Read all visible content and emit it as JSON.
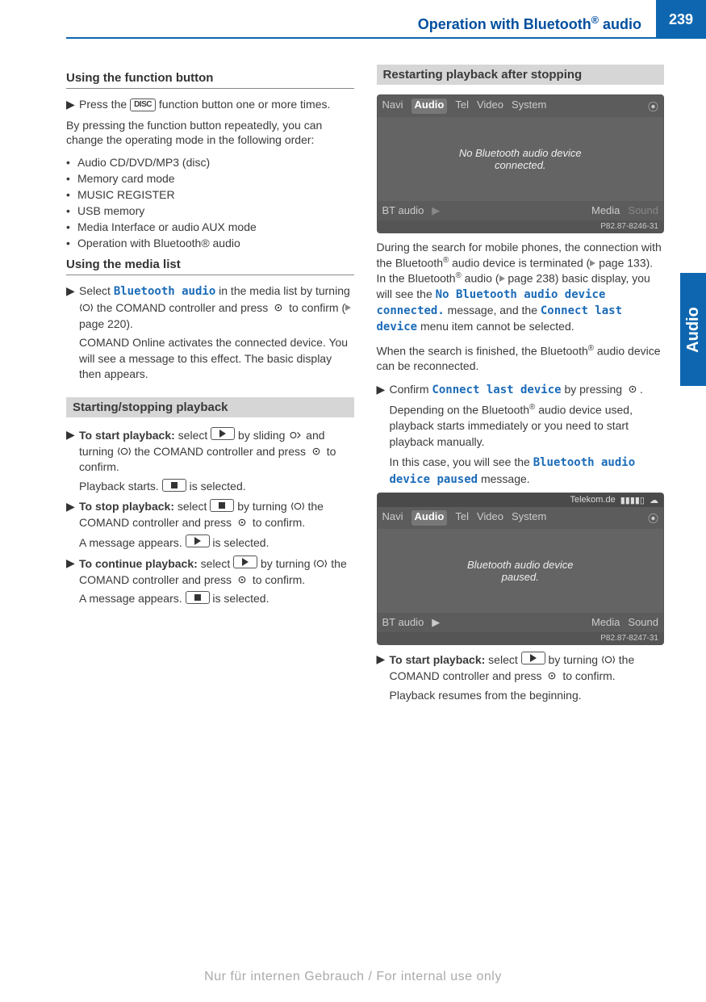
{
  "header": {
    "title_pre": "Operation with Bluetooth",
    "title_sup": "®",
    "title_post": " audio",
    "page_number": "239"
  },
  "side_tab": "Audio",
  "left": {
    "subhead1": "Using the function button",
    "disc_label": "DISC",
    "step1_pre": "Press the ",
    "step1_post": " function button one or more times.",
    "para1": "By pressing the function button repeatedly, you can change the operating mode in the following order:",
    "bullets": [
      "Audio CD/DVD/MP3 (disc)",
      "Memory card mode",
      "MUSIC REGISTER",
      "USB memory",
      "Media Interface or audio AUX mode",
      "Operation with Bluetooth® audio"
    ],
    "subhead2": "Using the media list",
    "bt_audio": "Bluetooth audio",
    "step2_pre": "Select ",
    "step2_mid1": " in the media list by turning ",
    "step2_mid2": " the COMAND controller and press ",
    "step2_post": " to confirm (",
    "page220": "page 220).",
    "step2_desc": "COMAND Online activates the connected device. You will see a message to this effect. The basic display then appears.",
    "section1": "Starting/stopping playback",
    "start_label": "To start playback:",
    "start_text1": " select ",
    "start_text2": " by sliding ",
    "start_text3": " and turning ",
    "start_text4": " the COMAND controller and press ",
    "start_text5": " to confirm.",
    "start_result_pre": "Playback starts. ",
    "start_result_post": " is selected.",
    "stop_label": "To stop playback:",
    "stop_text1": " select ",
    "stop_text2": " by turning ",
    "stop_text3": " the COMAND controller and press ",
    "stop_text4": " to confirm.",
    "stop_result_pre": "A message appears. ",
    "stop_result_post": " is selected.",
    "cont_label": "To continue playback:",
    "cont_text1": " select ",
    "cont_text2": " by turning ",
    "cont_text3": " the COMAND controller and press ",
    "cont_text4": " to confirm.",
    "cont_result_pre": "A message appears. ",
    "cont_result_post": " is selected."
  },
  "right": {
    "section1": "Restarting playback after stopping",
    "fig1": {
      "top": [
        "Navi",
        "Audio",
        "Tel",
        "Video",
        "System"
      ],
      "top_selected": 1,
      "middle_line1": "No Bluetooth audio device",
      "middle_line2": "connected.",
      "bottom": [
        "BT audio",
        "▶",
        "Media",
        "Sound"
      ],
      "bottom_dim": [
        1,
        3
      ],
      "id": "P82.87-8246-31"
    },
    "para1_pre": "During the search for mobile phones, the connection with the Bluetooth",
    "para1_mid1": " audio device is terminated (",
    "page133": "page 133). In the Bluetooth",
    "para1_mid2": " audio (",
    "page238": "page 238) basic display, you will see the ",
    "no_bt": "No Bluetooth audio device connected.",
    "para1_mid3": " message, and the ",
    "connect_last": "Connect last device",
    "para1_end": " menu item cannot be selected.",
    "para2_pre": "When the search is finished, the Bluetooth",
    "para2_post": " audio device can be reconnected.",
    "confirm_pre": "Confirm ",
    "confirm_mid": " by pressing ",
    "confirm_post": ".",
    "confirm_desc_pre": "Depending on the Bluetooth",
    "confirm_desc_post": " audio device used, playback starts immediately or you need to start playback manually.",
    "case_pre": "In this case, you will see the ",
    "bt_paused": "Bluetooth audio device paused",
    "case_post": " message.",
    "fig2": {
      "status_carrier": "Telekom.de",
      "top": [
        "Navi",
        "Audio",
        "Tel",
        "Video",
        "System"
      ],
      "top_selected": 1,
      "middle_line1": "Bluetooth audio device",
      "middle_line2": "paused.",
      "bottom": [
        "BT audio",
        "▶",
        "Media",
        "Sound"
      ],
      "id": "P82.87-8247-31"
    },
    "start2_label": "To start playback:",
    "start2_text1": " select ",
    "start2_text2": " by turning ",
    "start2_text3": " the COMAND controller and press ",
    "start2_text4": " to confirm.",
    "start2_result": "Playback resumes from the beginning."
  },
  "footer": "Nur für internen Gebrauch / For internal use only"
}
